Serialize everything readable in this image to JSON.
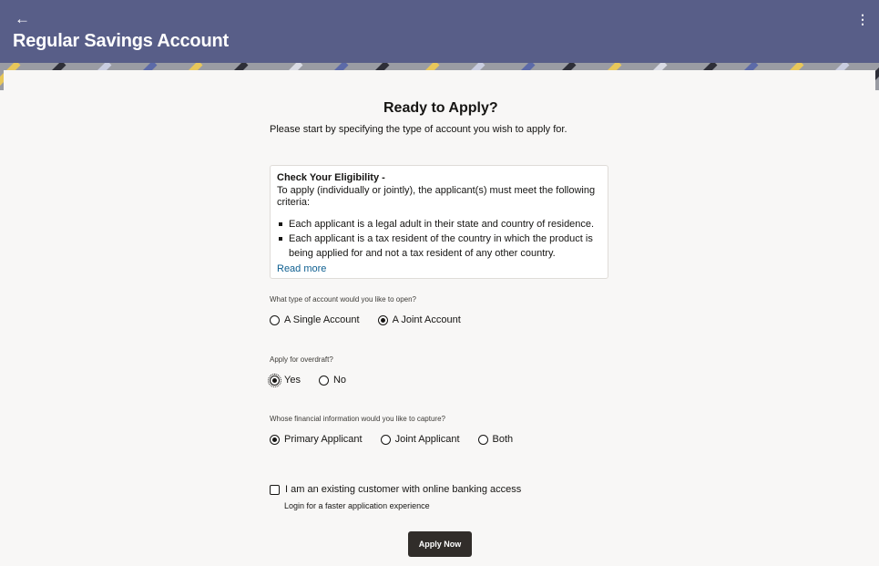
{
  "header": {
    "back_icon": "arrow-left-icon",
    "title": "Regular Savings Account",
    "menu_icon": "kebab-menu-icon",
    "background": "#585e88"
  },
  "main": {
    "heading": "Ready to Apply?",
    "intro": "Please start by specifying the type of account you wish to apply for."
  },
  "eligibility": {
    "title": "Check Your Eligibility -",
    "text": "To apply (individually or jointly), the applicant(s) must meet the following criteria:",
    "criteria": [
      "Each applicant is a legal adult in their state and country of residence.",
      "Each applicant is a tax resident of the country in which the product is being applied for and not a tax resident of any other country."
    ],
    "read_more": "Read more",
    "link_color": "#0e5f90"
  },
  "account_type": {
    "question": "What type of account would you like to open?",
    "options": [
      "A Single Account",
      "A Joint Account"
    ],
    "selected": "A Joint Account"
  },
  "overdraft": {
    "question": "Apply for overdraft?",
    "options": [
      "Yes",
      "No"
    ],
    "selected": "Yes"
  },
  "financial_info": {
    "question": "Whose financial information would you like to capture?",
    "options": [
      "Primary Applicant",
      "Joint Applicant",
      "Both"
    ],
    "selected": "Primary Applicant"
  },
  "existing_customer": {
    "label": "I am an existing customer with online banking access",
    "checked": false,
    "subtext": "Login for a faster application experience"
  },
  "apply_button": {
    "label": "Apply Now",
    "background": "#312d2a"
  }
}
